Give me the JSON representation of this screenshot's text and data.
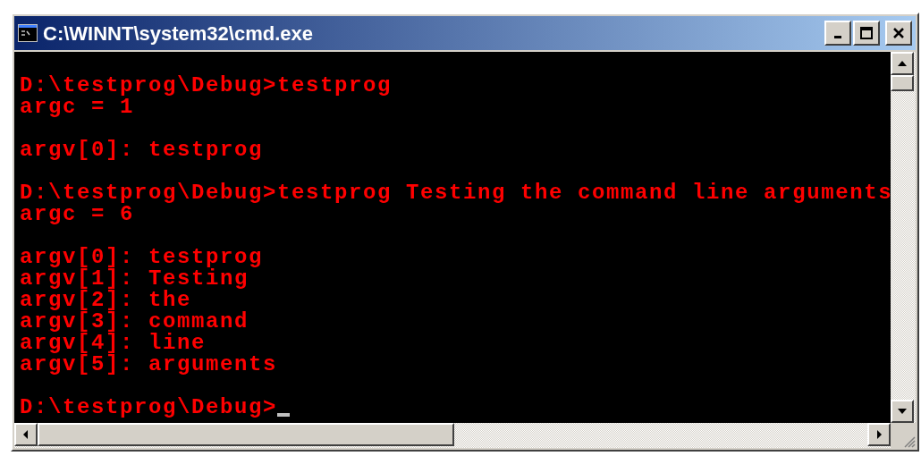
{
  "window": {
    "title": "C:\\WINNT\\system32\\cmd.exe",
    "buttons": [
      {
        "kind": "minimize"
      },
      {
        "kind": "maximize"
      },
      {
        "kind": "close"
      }
    ]
  },
  "console": {
    "blocks": [
      {
        "lines": [
          "D:\\testprog\\Debug>testprog",
          "argc = 1"
        ]
      },
      {
        "lines": [
          "argv[0]: testprog"
        ]
      },
      {
        "lines": [
          "D:\\testprog\\Debug>testprog Testing the command line arguments",
          "argc = 6"
        ]
      },
      {
        "lines": [
          "argv[0]: testprog",
          "argv[1]: Testing",
          "argv[2]: the",
          "argv[3]: command",
          "argv[4]: line",
          "argv[5]: arguments"
        ]
      },
      {
        "lines": [
          "D:\\testprog\\Debug>"
        ]
      }
    ],
    "cursor": true
  }
}
